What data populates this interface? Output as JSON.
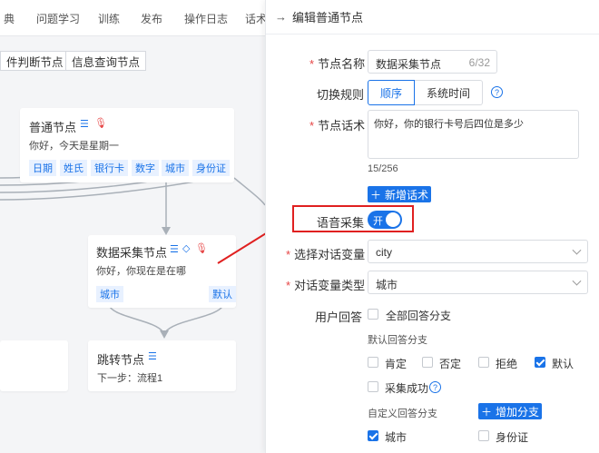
{
  "nav": {
    "tabs": [
      "典",
      "问题学习",
      "训练",
      "发布",
      "操作日志",
      "话术"
    ]
  },
  "toolbar": {
    "condition_node": "件判断节点",
    "info_query_node": "信息查询节点"
  },
  "nodes": {
    "normal": {
      "title": "普通节点",
      "text": "你好，今天是星期一",
      "tags": [
        "日期",
        "姓氏",
        "银行卡",
        "数字",
        "城市",
        "身份证"
      ]
    },
    "collect": {
      "title": "数据采集节点",
      "text": "你好，你现在是在哪",
      "tags": [
        "城市",
        "默认"
      ]
    },
    "jump": {
      "title": "跳转节点",
      "text": "下一步：流程1"
    }
  },
  "panel": {
    "title": "编辑普通节点",
    "node_name": {
      "label": "节点名称",
      "value": "数据采集节点",
      "count": "6/32"
    },
    "switch_rule": {
      "label": "切换规则",
      "options": [
        "顺序",
        "系统时间"
      ],
      "selected": "顺序"
    },
    "script": {
      "label": "节点话术",
      "value": "你好，你的银行卡号后四位是多少",
      "count": "15/256"
    },
    "add_script": "新增话术",
    "voice_collect": {
      "label": "语音采集",
      "state": "开"
    },
    "dialog_var": {
      "label": "选择对话变量",
      "value": "city"
    },
    "var_type": {
      "label": "对话变量类型",
      "value": "城市"
    },
    "user_reply": {
      "label": "用户回答",
      "all_branches": "全部回答分支",
      "default_title": "默认回答分支",
      "default_options": [
        {
          "label": "肯定",
          "checked": false
        },
        {
          "label": "否定",
          "checked": false
        },
        {
          "label": "拒绝",
          "checked": false
        },
        {
          "label": "默认",
          "checked": true
        }
      ],
      "collect_success": "采集成功",
      "custom_title": "自定义回答分支",
      "add_branch": "增加分支",
      "custom_options": [
        {
          "label": "城市",
          "checked": true
        },
        {
          "label": "身份证",
          "checked": false
        }
      ]
    }
  },
  "colors": {
    "primary": "#1a73e8",
    "required": "#e64545",
    "highlight": "#e02020"
  }
}
